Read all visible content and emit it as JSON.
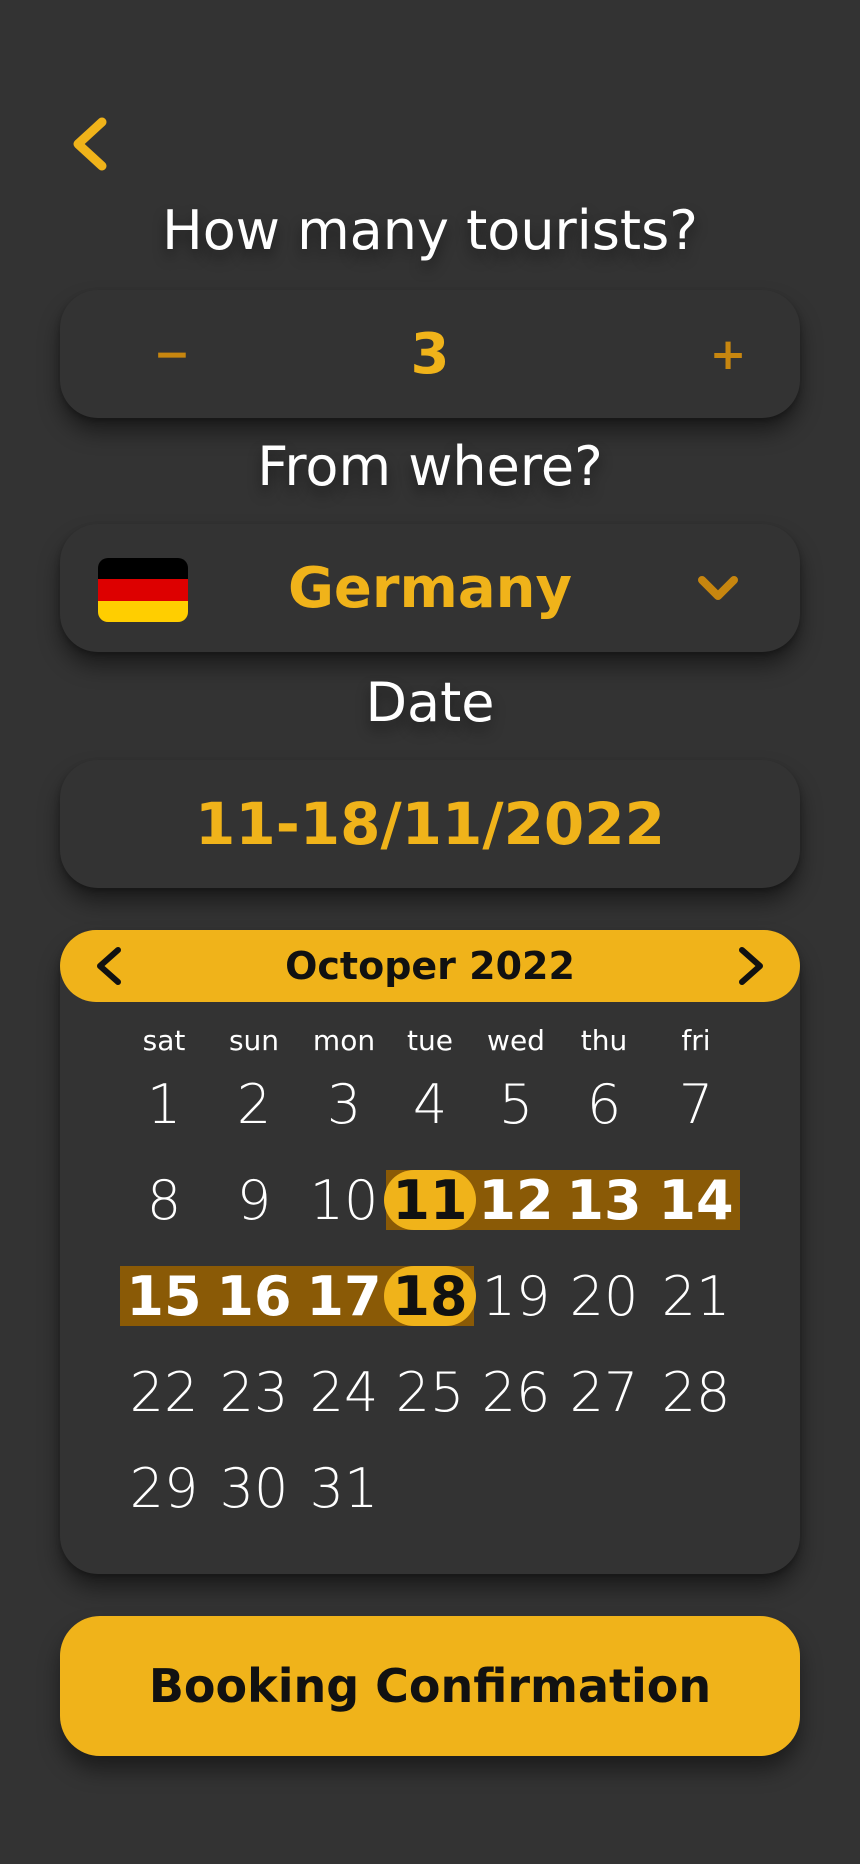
{
  "tourists": {
    "heading": "How many tourists?",
    "minus_label": "−",
    "count": "3",
    "plus_label": "+"
  },
  "origin": {
    "heading": "From where?",
    "country": "Germany",
    "flag_colors": [
      "#000000",
      "#dd0000",
      "#ffce00"
    ]
  },
  "date": {
    "heading": "Date",
    "range": "11-18/11/2022"
  },
  "calendar": {
    "month_title": "Octoper 2022",
    "weekdays": [
      "sat",
      "sun",
      "mon",
      "tue",
      "wed",
      "thu",
      "fri"
    ],
    "days": [
      "1",
      "2",
      "3",
      "4",
      "5",
      "6",
      "7",
      "8",
      "9",
      "10",
      "11",
      "12",
      "13",
      "14",
      "15",
      "16",
      "17",
      "18",
      "19",
      "20",
      "21",
      "22",
      "23",
      "24",
      "25",
      "26",
      "27",
      "28",
      "29",
      "30",
      "31"
    ],
    "range_start": 11,
    "range_end": 18
  },
  "confirm_label": "Booking Confirmation",
  "colors": {
    "background": "#333333",
    "accent": "#f0b31a",
    "range": "#8a5a06"
  },
  "icons": {
    "back": "chevron-left-icon",
    "dropdown": "chevron-down-icon",
    "prev_month": "chevron-left-icon",
    "next_month": "chevron-right-icon"
  }
}
